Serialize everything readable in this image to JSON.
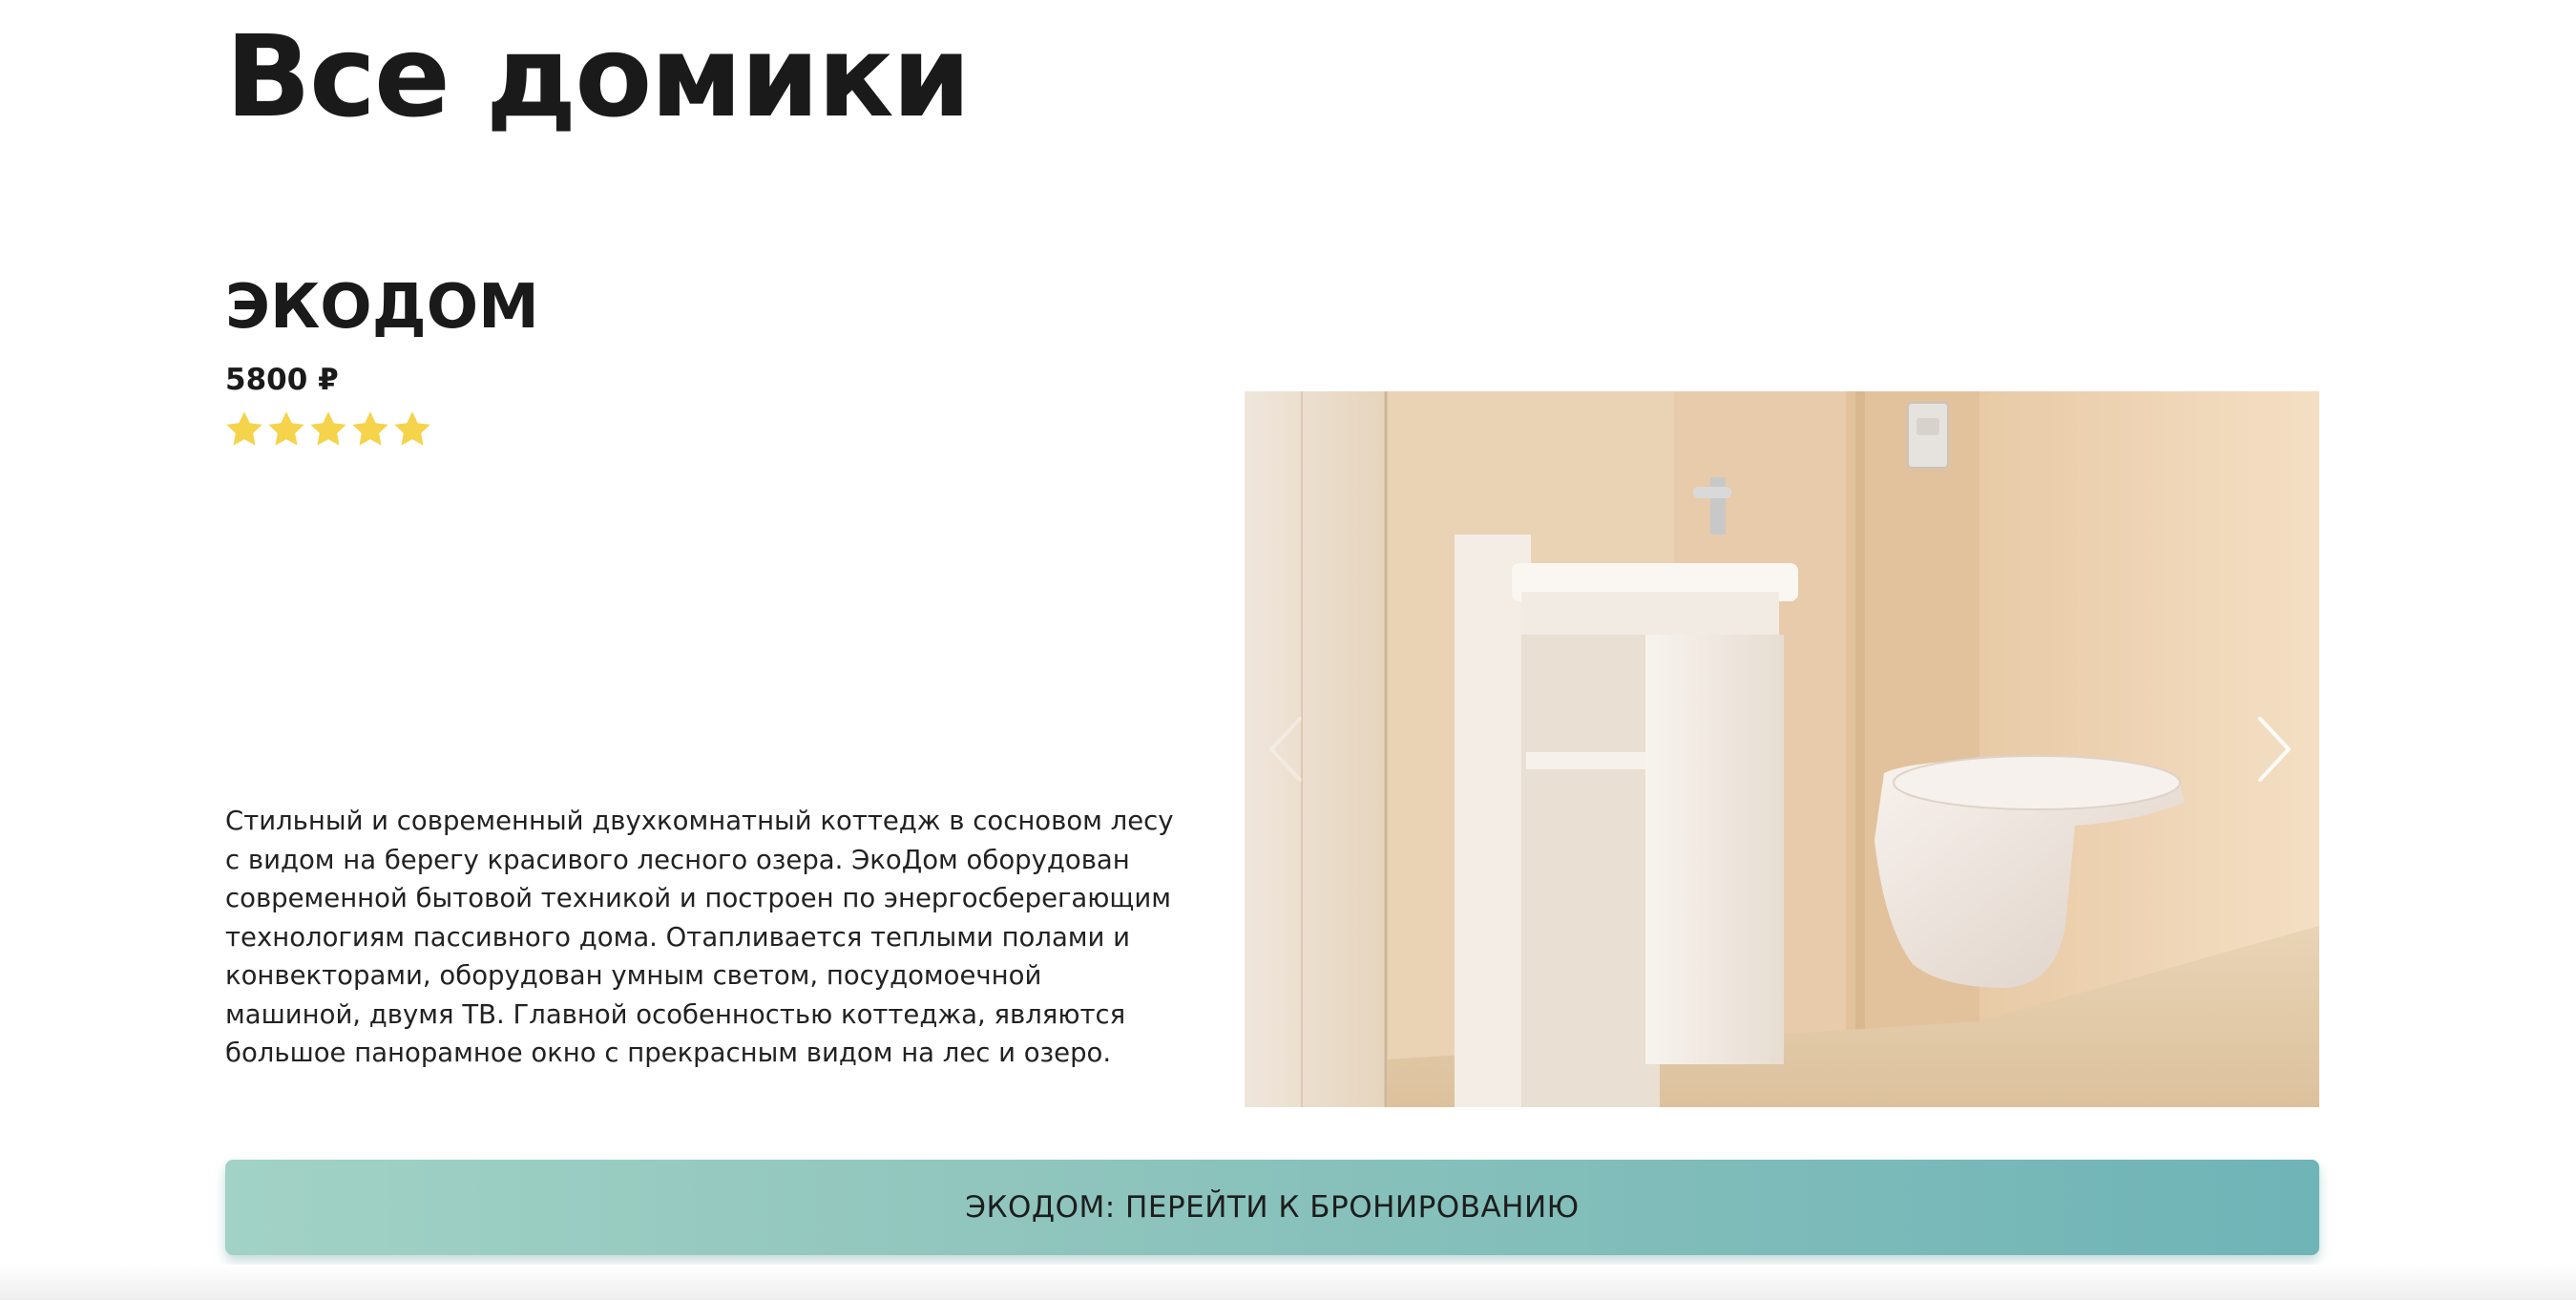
{
  "page": {
    "title": "Все домики"
  },
  "house": {
    "name": "ЭКОДОМ",
    "price": "5800 ₽",
    "rating_stars": 5,
    "rating_max": 5,
    "star_color": "#f5d34a",
    "description": "Стильный и современный двухкомнатный коттедж в сосновом лесу с видом на берегу красивого лесного озера. ЭкоДом оборудован современной бытовой техникой и построен по энергосберегающим технологиям пассивного дома. Отапливается теплыми полами и конвекторами, оборудован умным светом, посудомоечной машиной, двумя ТВ. Главной особенностью коттеджа, являются большое панорамное окно с прекрасным видом на лес и озеро.",
    "gallery": {
      "prev_icon": "chevron-left-icon",
      "next_icon": "chevron-right-icon"
    },
    "book_button_label": "ЭКОДОМ: ПЕРЕЙТИ К БРОНИРОВАНИЮ",
    "button_gradient": [
      "#a1d2c5",
      "#6fb4b7"
    ]
  }
}
